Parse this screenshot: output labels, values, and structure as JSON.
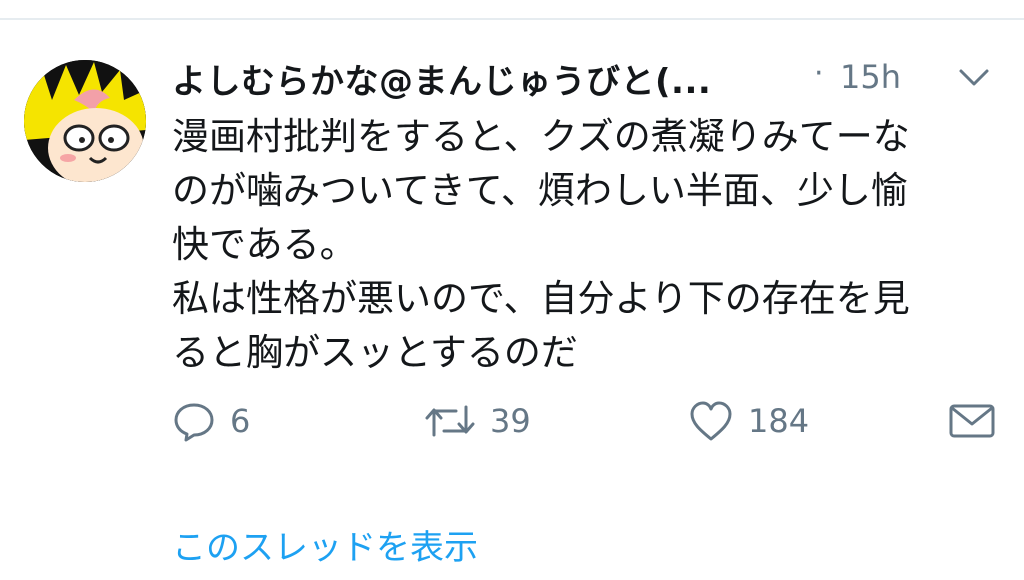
{
  "tweet": {
    "author": {
      "display_name": "よしむらかな@まんじゅうびと(...",
      "avatar_icon": "cartoon-avatar-icon"
    },
    "separator": "·",
    "time": "15h",
    "menu_icon": "chevron-down-icon",
    "text_lines": [
      "漫画村批判をすると、クズの煮凝りみてーな",
      "のが噛みついてきて、煩わしい半面、少し愉",
      "快である。",
      "私は性格が悪いので、自分より下の存在を見",
      "ると胸がスッとするのだ"
    ],
    "actions": {
      "reply": {
        "icon": "reply-icon",
        "count": "6"
      },
      "retweet": {
        "icon": "retweet-icon",
        "count": "39"
      },
      "like": {
        "icon": "heart-icon",
        "count": "184"
      },
      "dm": {
        "icon": "mail-icon"
      }
    },
    "show_thread": "このスレッドを表示"
  },
  "colors": {
    "text": "#14171a",
    "secondary": "#657786",
    "link": "#1da1f2",
    "divider": "#e6ecf0"
  }
}
